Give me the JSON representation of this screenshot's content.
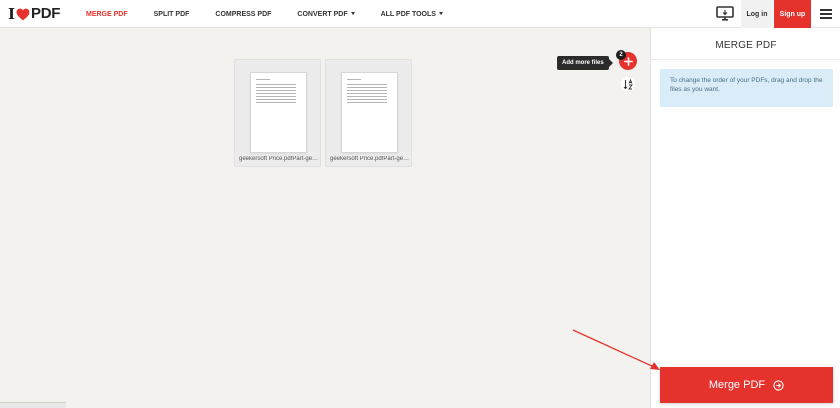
{
  "brand": {
    "i": "I",
    "pdf": "PDF",
    "heart_color": "#e5322d"
  },
  "nav": [
    {
      "label": "MERGE PDF",
      "active": true,
      "dropdown": false
    },
    {
      "label": "SPLIT PDF",
      "active": false,
      "dropdown": false
    },
    {
      "label": "COMPRESS PDF",
      "active": false,
      "dropdown": false
    },
    {
      "label": "CONVERT PDF",
      "active": false,
      "dropdown": true
    },
    {
      "label": "ALL PDF TOOLS",
      "active": false,
      "dropdown": true
    }
  ],
  "header": {
    "login_label": "Log in",
    "signup_label": "Sign up"
  },
  "files": [
    {
      "name": "geekersoft Price.pdfPart-gee..."
    },
    {
      "name": "geekersoft Price.pdfPart-gee..."
    }
  ],
  "workspace": {
    "add_tooltip": "Add more files",
    "file_count": "2"
  },
  "sidebar": {
    "title": "MERGE PDF",
    "info": "To change the order of your PDFs, drag and drop the files as you want.",
    "merge_label": "Merge PDF"
  },
  "colors": {
    "accent": "#e5322d",
    "info_bg": "#d9ecf7",
    "info_text": "#4a6f86",
    "workspace_bg": "#f4f2ee"
  },
  "icons": {
    "desktop": "desktop-icon",
    "menu": "hamburger-menu-icon",
    "add": "plus-icon",
    "sort": "sort-az-icon",
    "merge": "arrow-right-circle-icon"
  }
}
